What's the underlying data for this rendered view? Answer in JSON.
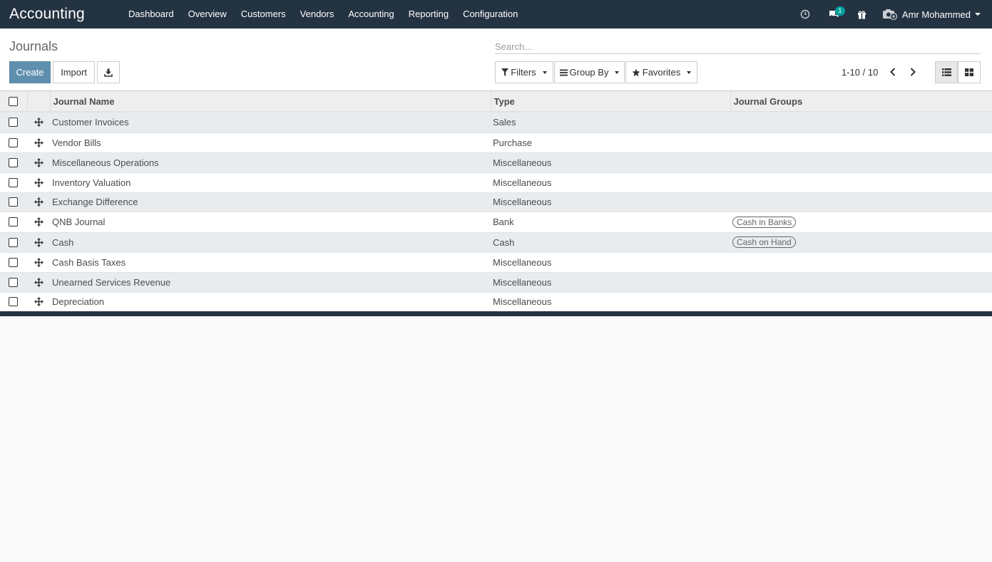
{
  "app": {
    "title": "Accounting"
  },
  "menu": [
    "Dashboard",
    "Overview",
    "Customers",
    "Vendors",
    "Accounting",
    "Reporting",
    "Configuration"
  ],
  "systray": {
    "messages_badge": "1",
    "user_name": "Amr Mohammed"
  },
  "breadcrumb": "Journals",
  "buttons": {
    "create": "Create",
    "import": "Import"
  },
  "search": {
    "placeholder": "Search..."
  },
  "search_buttons": {
    "filters": "Filters",
    "group_by": "Group By",
    "favorites": "Favorites"
  },
  "pager": {
    "value": "1-10 / 10"
  },
  "table": {
    "headers": {
      "name": "Journal Name",
      "type": "Type",
      "groups": "Journal Groups"
    },
    "rows": [
      {
        "name": "Customer Invoices",
        "type": "Sales",
        "group": ""
      },
      {
        "name": "Vendor Bills",
        "type": "Purchase",
        "group": ""
      },
      {
        "name": "Miscellaneous Operations",
        "type": "Miscellaneous",
        "group": ""
      },
      {
        "name": "Inventory Valuation",
        "type": "Miscellaneous",
        "group": ""
      },
      {
        "name": "Exchange Difference",
        "type": "Miscellaneous",
        "group": ""
      },
      {
        "name": "QNB Journal",
        "type": "Bank",
        "group": "Cash in Banks"
      },
      {
        "name": "Cash",
        "type": "Cash",
        "group": "Cash on Hand"
      },
      {
        "name": "Cash Basis Taxes",
        "type": "Miscellaneous",
        "group": ""
      },
      {
        "name": "Unearned Services Revenue",
        "type": "Miscellaneous",
        "group": ""
      },
      {
        "name": "Depreciation",
        "type": "Miscellaneous",
        "group": ""
      }
    ]
  },
  "colors": {
    "navbar": "#243342",
    "primary": "#5f8fae",
    "badge": "#00a09d"
  }
}
